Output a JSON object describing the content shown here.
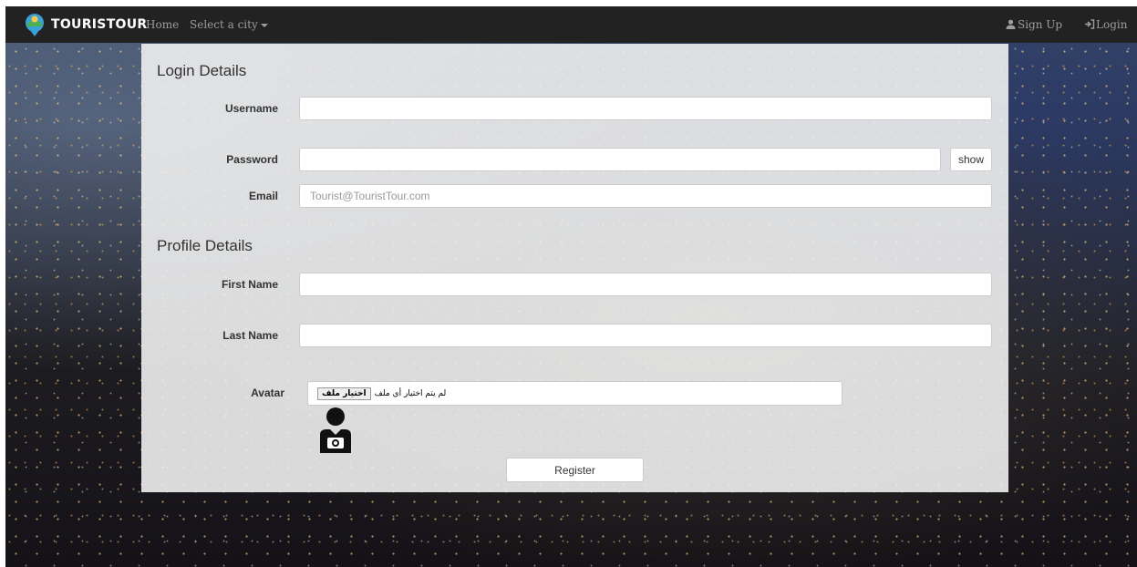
{
  "navbar": {
    "brand": "TOURISTOUR",
    "home": "Home",
    "select_city": "Select a city",
    "sign_up": "Sign Up",
    "login": "Login"
  },
  "login_details": {
    "title": "Login Details",
    "username_label": "Username",
    "username_value": "",
    "password_label": "Password",
    "password_value": "",
    "show_button": "show",
    "email_label": "Email",
    "email_placeholder": "Tourist@TouristTour.com"
  },
  "profile_details": {
    "title": "Profile Details",
    "first_name_label": "First Name",
    "first_name_value": "",
    "last_name_label": "Last Name",
    "last_name_value": "",
    "avatar_label": "Avatar",
    "file_button": "اختيار ملف",
    "file_status": "لم يتم اختيار أي ملف",
    "avatar_icon": "user-camera-icon"
  },
  "register_button": "Register",
  "colors": {
    "navbar_bg": "#222222",
    "nav_text": "#9d9d9d",
    "panel_bg": "#f0f0f0"
  }
}
